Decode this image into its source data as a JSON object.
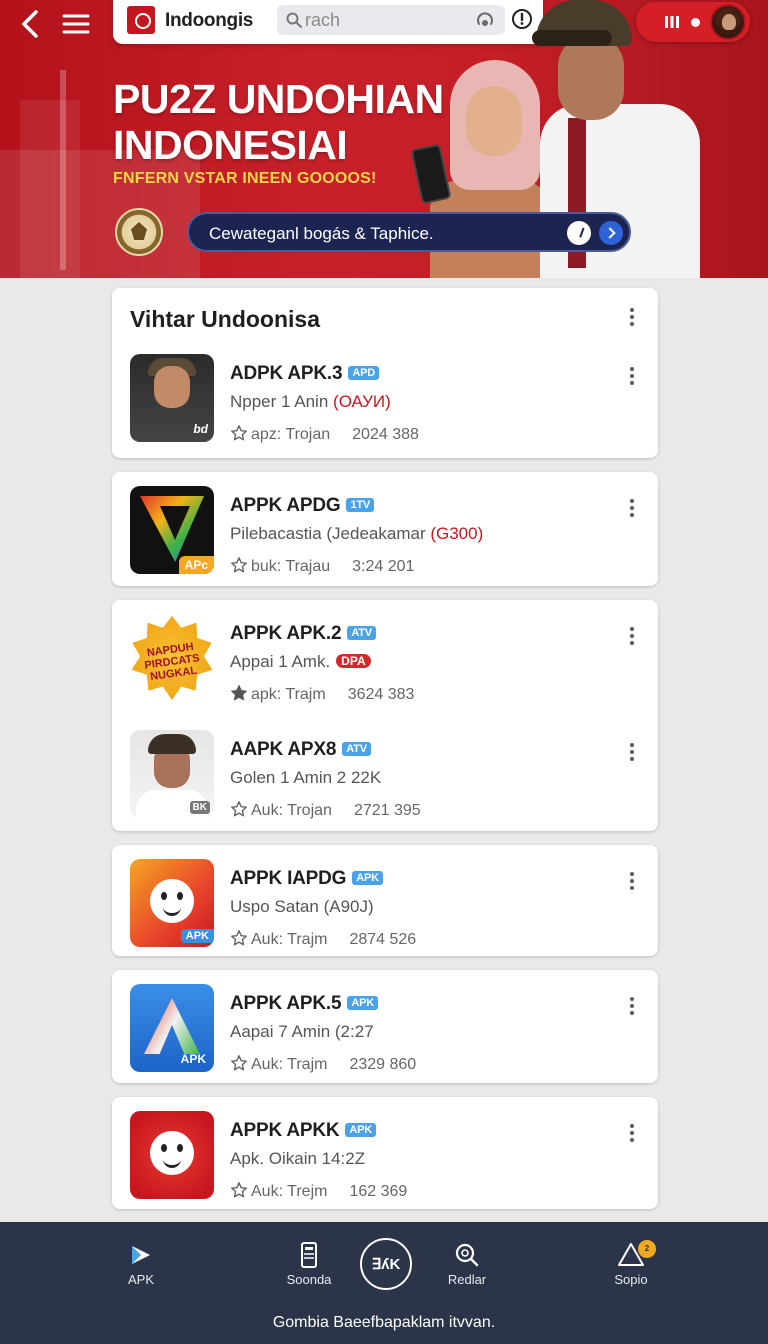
{
  "header": {
    "brand": "Indoongis",
    "search_placeholder": "rach"
  },
  "hero": {
    "title_line1": "PU2Z UNDOHIAN",
    "title_line2": "INDONESIAI",
    "subtitle": "FNFERN VSTAR INEEN GOOOOS!",
    "search_text": "Cewateganl bogás & Taphice."
  },
  "section": {
    "title": "Vihtar Undoonisa"
  },
  "apps": [
    {
      "name": "ADPK APK.3",
      "badge": "APD",
      "desc": "Npper 1 Anin",
      "desc_hl": "(ОАУИ)",
      "meta": "apz: Trojan",
      "date": "2024 388",
      "icon": "man-portrait-icon",
      "icon_tag": "bd"
    },
    {
      "name": "APPK APDG",
      "badge": "1TV",
      "desc": "Pilebacastia (Jedeakamar",
      "desc_hl": "(G300)",
      "meta": "buk: Trajau",
      "date": "3:24 201",
      "icon": "play-triangle-icon",
      "icon_tag": "APc"
    },
    {
      "name": "APPK APK.2",
      "badge": "ATV",
      "desc": "Appai 1 Amk.",
      "desc_pill": "DPA",
      "meta": "apk: Trajm",
      "date": "3624 383",
      "icon": "starburst-badge-icon",
      "icon_tag": "NAPDUH PIRDCATS NUGKAL"
    },
    {
      "name": "AAPK APX8",
      "badge": "ATV",
      "desc": "Golen 1 Amin 2 22K",
      "meta": "Auk: Trojan",
      "date": "2721 395",
      "icon": "officer-portrait-icon",
      "icon_tag": "BK"
    },
    {
      "name": "APPK IAPDG",
      "badge": "APK",
      "desc": "Uspo Satan",
      "desc_plain2": "(A90J)",
      "meta": "Auk: Trajm",
      "date": "2874 526",
      "icon": "smiley-orange-icon",
      "icon_tag": "APK"
    },
    {
      "name": "APPK APK.5",
      "badge": "APK",
      "desc": "Aapai 7 Amin (2:27",
      "meta": "Auk: Trajm",
      "date": "2329 860",
      "icon": "letter-a-icon",
      "icon_tag": "APK"
    },
    {
      "name": "APPK APKK",
      "badge": "APK",
      "desc": "Apk. Oikain 14:2Z",
      "meta": "Auk: Trejm",
      "date": "162 369",
      "icon": "smiley-red-icon",
      "icon_tag": ""
    }
  ],
  "bottom_nav": {
    "items": [
      {
        "label": "APK",
        "icon": "apk-logo-icon"
      },
      {
        "label": "Soonda",
        "icon": "phone-icon"
      },
      {
        "label": "∃ʎK",
        "icon": "center-logo-icon"
      },
      {
        "label": "Redlar",
        "icon": "search-icon"
      },
      {
        "label": "Sopio",
        "icon": "warning-icon",
        "badge": "2"
      }
    ],
    "footer": "Gombia Baeefbapaklam itvvan."
  },
  "colors": {
    "brand_red": "#c8202a",
    "nav_bg": "#2c3449",
    "badge_blue": "#4aa3e8",
    "accent_yellow": "#f4d54a"
  }
}
